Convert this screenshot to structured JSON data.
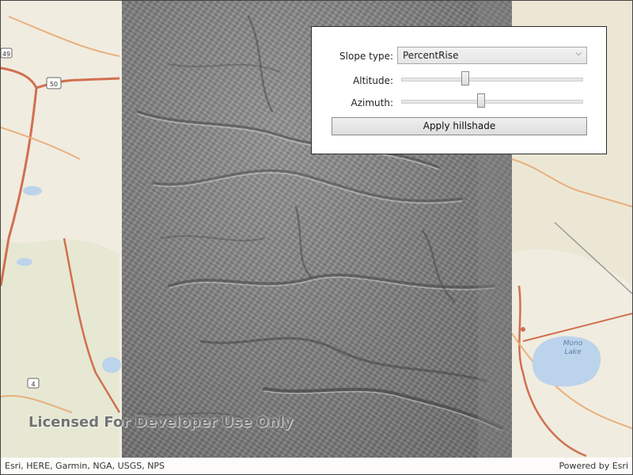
{
  "map": {
    "watermark": "Licensed For Developer Use Only",
    "attribution": "Esri, HERE, Garmin, NGA, USGS, NPS",
    "powered_by": "Powered by Esri",
    "labels": {
      "route_50": "50",
      "route_49": "49",
      "route_4": "4",
      "lake_name_1": "Mono",
      "lake_name_2": "Lake"
    }
  },
  "panel": {
    "slope_label": "Slope type:",
    "slope_value": "PercentRise",
    "altitude_label": "Altitude:",
    "azimuth_label": "Azimuth:",
    "altitude_fraction": 0.35,
    "azimuth_fraction": 0.44,
    "apply_label": "Apply hillshade"
  },
  "colors": {
    "highway": "#d0704f",
    "road_minor": "#e8b07c",
    "water": "#bcd3ec",
    "land": "#f1ece0"
  }
}
